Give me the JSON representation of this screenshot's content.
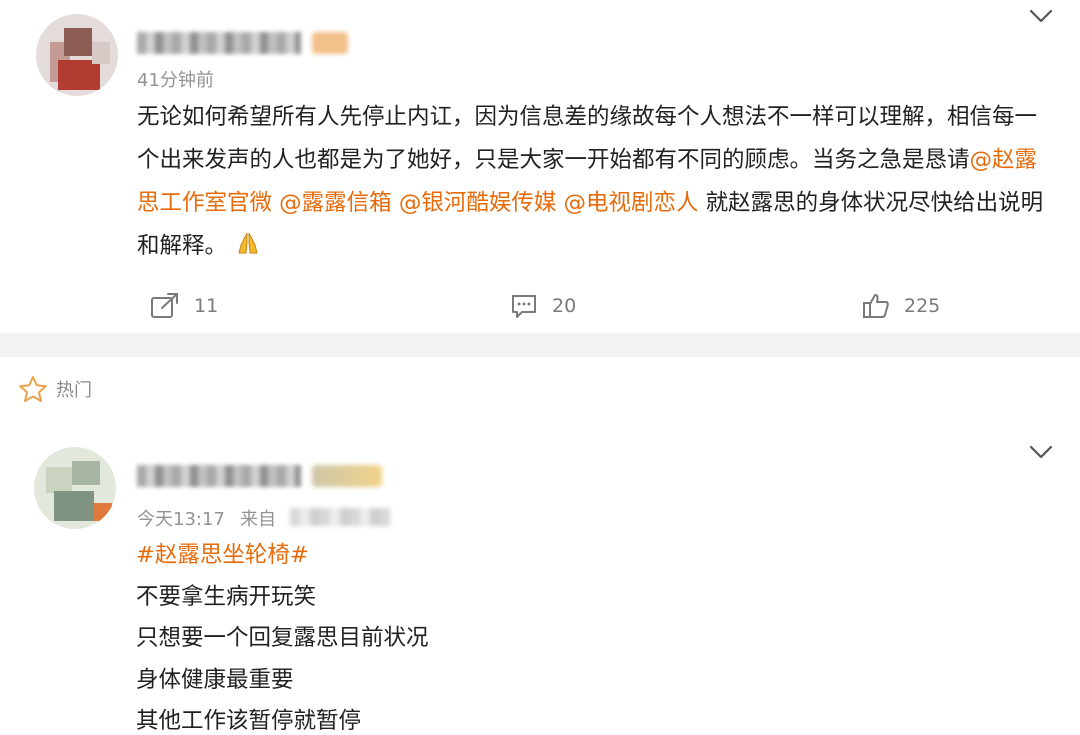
{
  "post": {
    "time": "41分钟前",
    "text_before": "无论如何希望所有人先停止内讧，因为信息差的缘故每个人想法不一样可以理解，相信每一个出来发声的人也都是为了她好，只是大家一开始都有不同的顾虑。当务之急是恳请",
    "mentions": [
      "@赵露思工作室官微",
      "@露露信箱",
      "@银河酷娱传媒",
      "@电视剧恋人"
    ],
    "text_after": " 就赵露思的身体状况尽快给出说明和解释。",
    "emoji": "🙏",
    "repost_count": "11",
    "comment_count": "20",
    "like_count": "225"
  },
  "hot_section": {
    "label": "热门"
  },
  "reply": {
    "time": "今天13:17",
    "source_prefix": "来自",
    "hashtag": "#赵露思坐轮椅#",
    "lines": [
      "不要拿生病开玩笑",
      "只想要一个回复露思目前状况",
      "身体健康最重要",
      "其他工作该暂停就暂停"
    ]
  },
  "colors": {
    "accent": "#e86b0b",
    "meta_gray": "#939393",
    "band": "#f2f2f2"
  },
  "icons": {
    "repost": "repost-icon",
    "comment": "comment-icon",
    "like": "thumbs-up-icon",
    "star": "star-icon",
    "more": "chevron-down-icon"
  }
}
